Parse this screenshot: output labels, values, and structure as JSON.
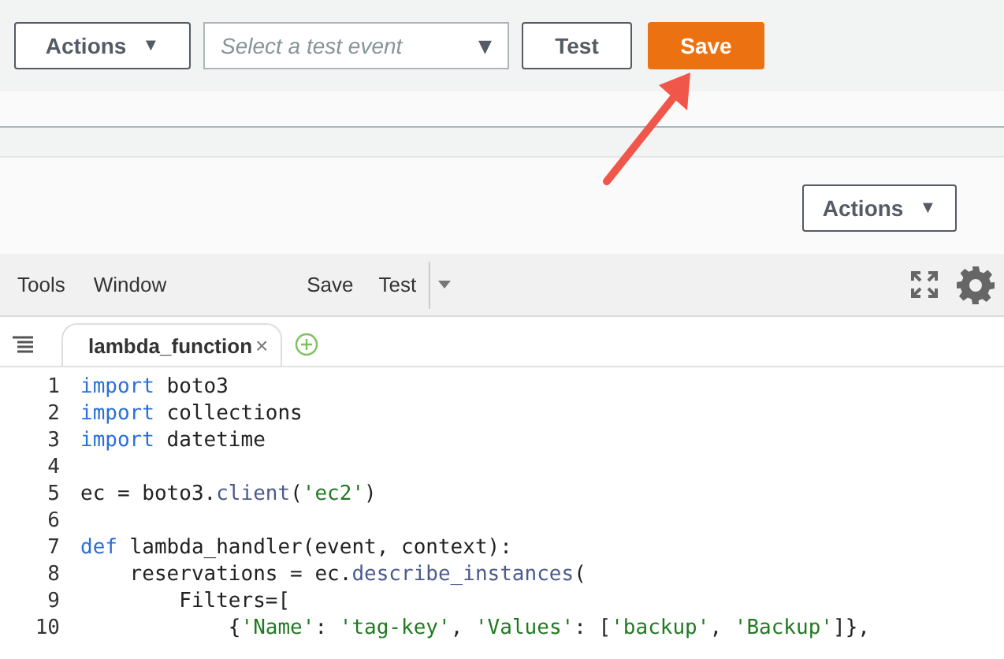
{
  "top_bar": {
    "actions_button": {
      "label": "Actions",
      "caret": "▼"
    },
    "test_event_select": {
      "placeholder": "Select a test event",
      "caret": "▼"
    },
    "test_button": {
      "label": "Test"
    },
    "save_button": {
      "label": "Save"
    }
  },
  "panel": {
    "actions_button": {
      "label": "Actions",
      "caret": "▼"
    }
  },
  "editor_toolbar": {
    "menus": [
      "Tools",
      "Window"
    ],
    "actions": [
      "Save",
      "Test"
    ]
  },
  "tabs": [
    {
      "label": "lambda_function",
      "close": "×",
      "selected": true
    }
  ],
  "code_lines": [
    {
      "number": "1",
      "tokens": [
        {
          "kind": "keyword",
          "text": "import"
        },
        {
          "kind": "plain",
          "text": " boto3"
        }
      ]
    },
    {
      "number": "2",
      "tokens": [
        {
          "kind": "keyword",
          "text": "import"
        },
        {
          "kind": "plain",
          "text": " collections"
        }
      ]
    },
    {
      "number": "3",
      "tokens": [
        {
          "kind": "keyword",
          "text": "import"
        },
        {
          "kind": "plain",
          "text": " datetime"
        }
      ]
    },
    {
      "number": "4"
    },
    {
      "number": "5",
      "tokens": [
        {
          "kind": "plain",
          "text": "ec = boto3."
        },
        {
          "kind": "method",
          "text": "client"
        },
        {
          "kind": "plain",
          "text": "("
        },
        {
          "kind": "string",
          "text": "'ec2'"
        },
        {
          "kind": "plain",
          "text": ")"
        }
      ]
    },
    {
      "number": "6"
    },
    {
      "number": "7",
      "tokens": [
        {
          "kind": "keyword",
          "text": "def"
        },
        {
          "kind": "plain",
          "text": " lambda_handler(event, context):"
        }
      ]
    },
    {
      "number": "8",
      "tokens": [
        {
          "kind": "plain",
          "text": "    reservations = ec."
        },
        {
          "kind": "method",
          "text": "describe_instances"
        },
        {
          "kind": "plain",
          "text": "("
        }
      ]
    },
    {
      "number": "9",
      "tokens": [
        {
          "kind": "plain",
          "text": "        Filters=["
        }
      ]
    },
    {
      "number": "10",
      "tokens": [
        {
          "kind": "plain",
          "text": "            {"
        },
        {
          "kind": "string",
          "text": "'Name'"
        },
        {
          "kind": "plain",
          "text": ": "
        },
        {
          "kind": "string",
          "text": "'tag-key'"
        },
        {
          "kind": "plain",
          "text": ", "
        },
        {
          "kind": "string",
          "text": "'Values'"
        },
        {
          "kind": "plain",
          "text": ": ["
        },
        {
          "kind": "string",
          "text": "'backup'"
        },
        {
          "kind": "plain",
          "text": ", "
        },
        {
          "kind": "string",
          "text": "'Backup'"
        },
        {
          "kind": "plain",
          "text": "]},"
        }
      ]
    }
  ]
}
